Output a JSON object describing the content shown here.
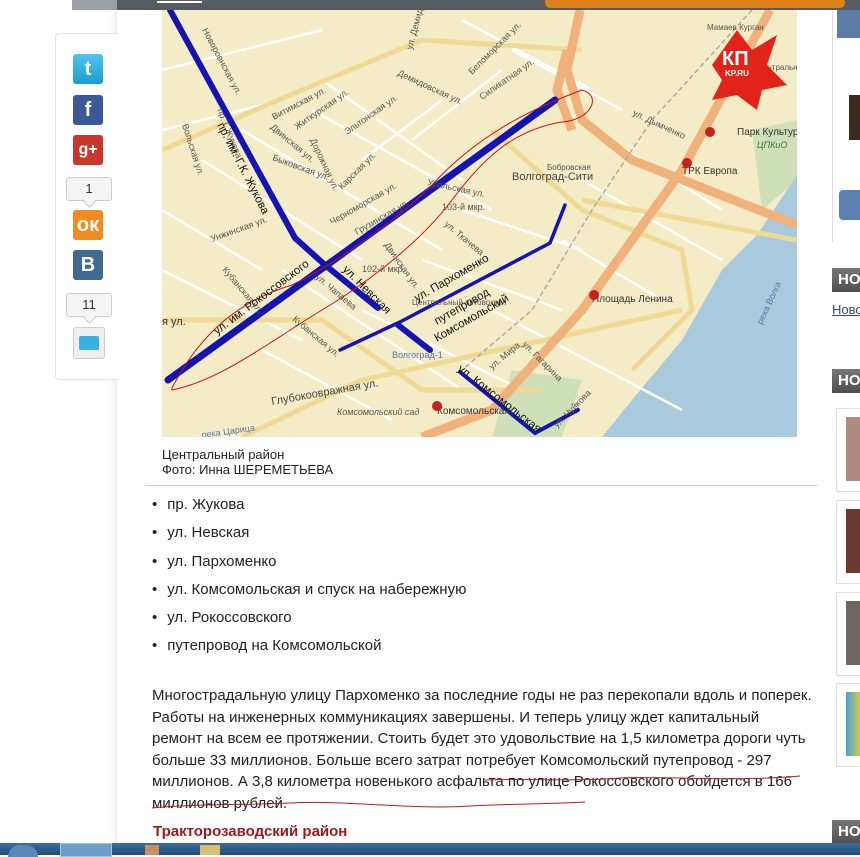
{
  "social": {
    "ok_count": "1",
    "comments_count": "11",
    "icons": [
      "twitter-icon",
      "facebook-icon",
      "google-plus-icon",
      "odnoklassniki-icon",
      "vkontakte-icon",
      "comment-icon"
    ]
  },
  "map": {
    "labels": {
      "zhukov": "пр. им. Г.К. Жукова",
      "zhukov_small": "пр. Г.Жукова",
      "novorossiyskaya": "Новоровнская ул.",
      "vitimskaya": "Витимская ул.",
      "zhitkurskaya": "Житкурская ул.",
      "eltonskaya": "Эльтонская ул.",
      "dorozhnaya": "Дорожная ул.",
      "dvinskaya": "Двинская ул.",
      "bykovskaya": "Быковская ул.",
      "karskaya": "Карская ул.",
      "chernomorskaya": "Черноморская ул.",
      "gruzinskaya": "Грузинская ул.",
      "demidovskaya": "Демидовская ул.",
      "demidovskaya2": "ул. Демидовская",
      "belomorskaya": "Беломорская ул.",
      "silikatnaya": "Силикатная ул.",
      "volskaya": "Вольская ул.",
      "unzhinskaya": "Унжинская ул.",
      "kubanskaya": "Кубанская ул.",
      "kubanskaya2": "Кубанская ул.",
      "chapaeva": "ул. Чапаева",
      "tkacheva": "ул. Ткачева",
      "dvinskaya2": "Двинская ул.",
      "uralskaya": "Уральская ул.",
      "mkr102": "102-й мкр.",
      "mkr103": "103-й мкр.",
      "volgograd_city": "Волгоград-Сити",
      "bobrovskaya": "Бобровская",
      "volgograd1": "Волгоград-1",
      "vokzal": "Центральный автовокзал",
      "glubokoovrazhnaya": "Глубокоовражная ул.",
      "komsomolsky_sad": "Комсомольский сад",
      "tsaritsa": "река Царица",
      "mira": "ул. Мира",
      "gagarina": "ул. Гагарина",
      "chuikova": "ул. Чуйкова",
      "dymchenko": "ул. Дымченко",
      "park_kultury": "Парк Культуры",
      "tspkio": "ЦПКиО",
      "trk_evropa": "ТРК Европа",
      "ploshchad_lenina": "Площадь Ленина",
      "komsomolskaya_st": "Комсомольская",
      "reka_volga": "река Волга",
      "mamaev": "Мамаев Курган",
      "district": "Центральный район",
      "rokossovsky": "ул. им. Рокоссовского",
      "nevskaya": "ул. Невская",
      "parkhomenko": "ул. Пархоменко",
      "puteprovod": "путепровод",
      "komsomolsky": "Комсомольский",
      "komsomolskaya": "ул. Комсомольская",
      "rokoss_short": "я ул."
    },
    "logo": "КП KP.RU",
    "colors": {
      "route": "#1414b4",
      "annotation": "#d01010",
      "water": "#a9c9dc",
      "land": "#f4ecc6"
    }
  },
  "caption": {
    "title": "Центральный район",
    "photo": "Фото: Инна ШЕРЕМЕТЬЕВА"
  },
  "list": [
    "пр. Жукова",
    "ул. Невская",
    "ул. Пархоменко",
    "ул. Комсомольская и спуск на набережную",
    "ул. Рокоссовского",
    "путепровод на Комсомольской"
  ],
  "paragraph": "Многострадальную улицу Пархоменко за последние годы не раз перекопали вдоль и поперек. Работы на инженерных коммуникациях завершены. И теперь улицу ждет капитальный ремонт на всем ее протяжении. Стоить будет это удовольствие на 1,5 километра дороги чуть больше 33 миллионов. Больше всего затрат потребует Комсомольский путепровод - 297 миллионов. А 3,8 километра новенького асфальта по улице Рокоссовского обойдется в 166 миллионов рублей.",
  "next_heading": "Тракторозаводский район",
  "sidebar": {
    "headers": [
      "НО",
      "НО",
      "НО"
    ],
    "link": "Новос"
  }
}
